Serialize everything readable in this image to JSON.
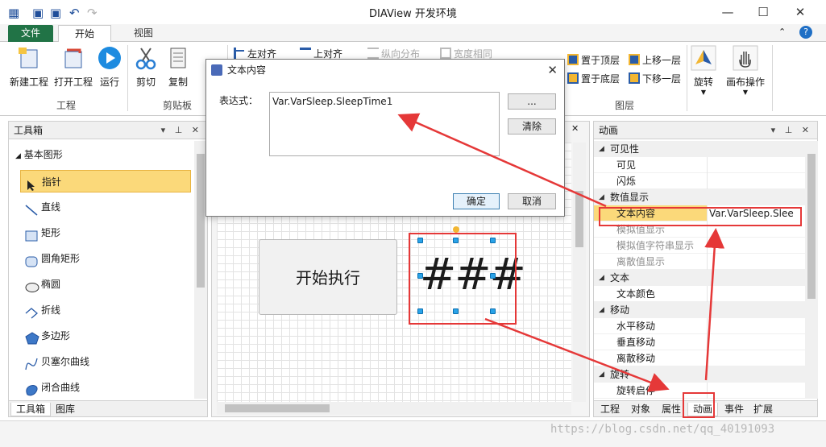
{
  "window": {
    "title": "DIAView 开发环境",
    "controls": [
      "—",
      "☐",
      "✕"
    ]
  },
  "ribbon": {
    "tabs": [
      "文件",
      "开始",
      "视图"
    ],
    "buttons": {
      "new_project": "新建工程",
      "open_project": "打开工程",
      "run": "运行",
      "cut": "剪切",
      "copy": "复制",
      "align_left": "左对齐",
      "align_top": "上对齐",
      "distribute_vertical": "纵向分布",
      "same_width": "宽度相同",
      "bring_to_top": "置于顶层",
      "move_up": "上移一层",
      "send_to_bottom": "置于底层",
      "move_down": "下移一层",
      "rotate": "旋转",
      "canvas_ops": "画布操作"
    },
    "groups": {
      "project": "工程",
      "clipboard": "剪贴板",
      "layer": "图层"
    }
  },
  "toolbox": {
    "title": "工具箱",
    "section": "基本图形",
    "items": [
      "指针",
      "直线",
      "矩形",
      "圆角矩形",
      "椭圆",
      "折线",
      "多边形",
      "贝塞尔曲线",
      "闭合曲线"
    ],
    "bottom_tabs": [
      "工具箱",
      "图库"
    ]
  },
  "canvas": {
    "button_text": "开始执行",
    "display_text": "###"
  },
  "dialog": {
    "title": "文本内容",
    "label": "表达式：",
    "expression": "Var.VarSleep.SleepTime1",
    "browse_button": "...",
    "clear_button": "清除",
    "ok_button": "确定",
    "cancel_button": "取消"
  },
  "properties": {
    "title": "动画",
    "rows": [
      {
        "kind": "cat",
        "name": "可见性"
      },
      {
        "kind": "sub",
        "name": "可见"
      },
      {
        "kind": "sub",
        "name": "闪烁"
      },
      {
        "kind": "cat",
        "name": "数值显示"
      },
      {
        "kind": "sub",
        "name": "文本内容",
        "value": "Var.VarSleep.Slee",
        "highlight": true
      },
      {
        "kind": "sub",
        "name": "模拟值显示",
        "greyed": true
      },
      {
        "kind": "sub",
        "name": "模拟值字符串显示",
        "greyed": true
      },
      {
        "kind": "sub",
        "name": "离散值显示",
        "greyed": true
      },
      {
        "kind": "cat",
        "name": "文本"
      },
      {
        "kind": "sub",
        "name": "文本颜色"
      },
      {
        "kind": "cat",
        "name": "移动"
      },
      {
        "kind": "sub",
        "name": "水平移动"
      },
      {
        "kind": "sub",
        "name": "垂直移动"
      },
      {
        "kind": "sub",
        "name": "离散移动"
      },
      {
        "kind": "cat",
        "name": "旋转"
      },
      {
        "kind": "sub",
        "name": "旋转启停"
      }
    ],
    "bottom_tabs": [
      "工程",
      "对象",
      "属性",
      "动画",
      "事件",
      "扩展"
    ]
  },
  "watermark": "https://blog.csdn.net/qq_40191093",
  "colors": {
    "file_tab": "#217346",
    "highlight": "#fbd97a",
    "annotation": "#e53838",
    "handle": "#2aa3e8"
  }
}
